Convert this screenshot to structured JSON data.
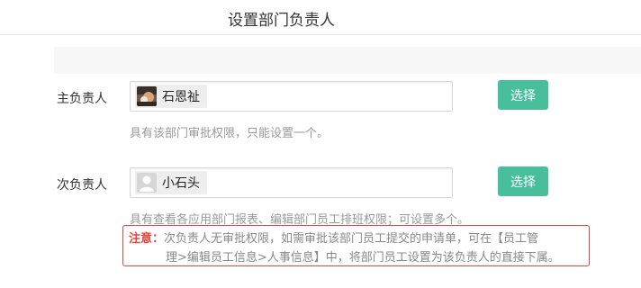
{
  "header": {
    "title": "设置部门负责人"
  },
  "primary": {
    "label": "主负责人",
    "selected_user": "石恩祉",
    "select_button": "选择",
    "hint": "具有该部门审批权限，只能设置一个。"
  },
  "secondary": {
    "label": "次负责人",
    "selected_user": "小石头",
    "select_button": "选择",
    "hint": "具有查看各应用部门报表、编辑部门员工排班权限；可设置多个。"
  },
  "note": {
    "label": "注意：",
    "line1": "次负责人无审批权限，如需审批该部门员工提交的申请单，可在【员工管",
    "line2": "理>编辑员工信息>人事信息】中，将部门员工设置为该负责人的直接下属。"
  },
  "icons": {
    "primary_avatar": "user-photo-avatar",
    "secondary_avatar": "default-user-avatar"
  },
  "colors": {
    "accent": "#46bf9a",
    "warning": "#e8443a",
    "hint": "#999999"
  }
}
